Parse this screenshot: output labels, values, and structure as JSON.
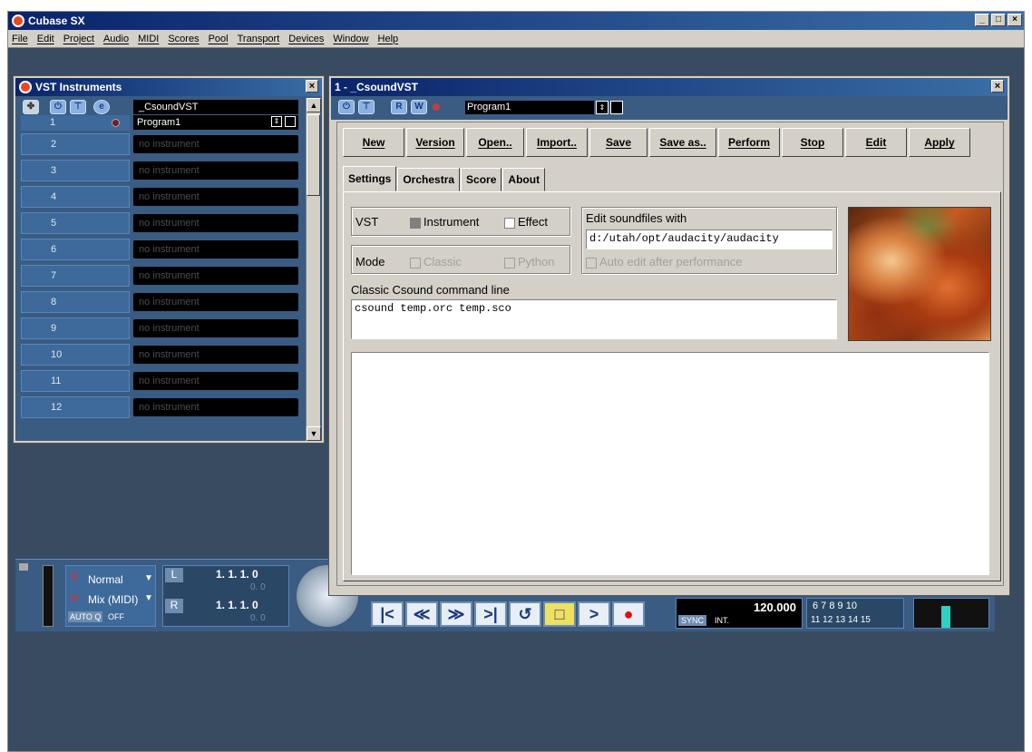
{
  "app": {
    "title": "Cubase SX",
    "menu": [
      "File",
      "Edit",
      "Project",
      "Audio",
      "MIDI",
      "Scores",
      "Pool",
      "Transport",
      "Devices",
      "Window",
      "Help"
    ]
  },
  "vst_window": {
    "title": "VST Instruments",
    "instrument_name": "_CsoundVST",
    "program": "Program1",
    "slots": [
      {
        "num": "1",
        "name": ""
      },
      {
        "num": "2",
        "name": "no instrument"
      },
      {
        "num": "3",
        "name": "no instrument"
      },
      {
        "num": "4",
        "name": "no instrument"
      },
      {
        "num": "5",
        "name": "no instrument"
      },
      {
        "num": "6",
        "name": "no instrument"
      },
      {
        "num": "7",
        "name": "no instrument"
      },
      {
        "num": "8",
        "name": "no instrument"
      },
      {
        "num": "9",
        "name": "no instrument"
      },
      {
        "num": "10",
        "name": "no instrument"
      },
      {
        "num": "11",
        "name": "no instrument"
      },
      {
        "num": "12",
        "name": "no instrument"
      }
    ],
    "e_label": "e"
  },
  "csound_window": {
    "title": "1 - _CsoundVST",
    "program": "Program1",
    "r_label": "R",
    "w_label": "W",
    "buttons": [
      "New",
      "Version",
      "Open..",
      "Import..",
      "Save",
      "Save as..",
      "Perform",
      "Stop",
      "Edit",
      "Apply"
    ],
    "tabs": [
      "Settings",
      "Orchestra",
      "Score",
      "About"
    ],
    "settings": {
      "vst_label": "VST",
      "instrument_label": "Instrument",
      "effect_label": "Effect",
      "mode_label": "Mode",
      "classic_label": "Classic",
      "python_label": "Python",
      "edit_soundfiles_label": "Edit soundfiles with",
      "edit_soundfiles_value": "d:/utah/opt/audacity/audacity",
      "auto_edit_label": "Auto edit after performance",
      "command_line_label": "Classic Csound command line",
      "command_line_value": "csound  temp.orc temp.sco"
    }
  },
  "transport": {
    "mode": "Normal",
    "mix": "Mix (MIDI)",
    "autoq": "AUTO Q",
    "autoq_state": "OFF",
    "left_locator": "1. 1. 1.   0",
    "right_locator": "1. 1. 1.   0",
    "left_sub": "0.    0",
    "right_sub": "0.    0",
    "tempo": "120.000",
    "sync": "SYNC",
    "int": "INT.",
    "markers_top": "6  7  8  9  10",
    "markers_bottom": "11  12  13  14  15",
    "l_label": "L",
    "r_label": "R"
  }
}
